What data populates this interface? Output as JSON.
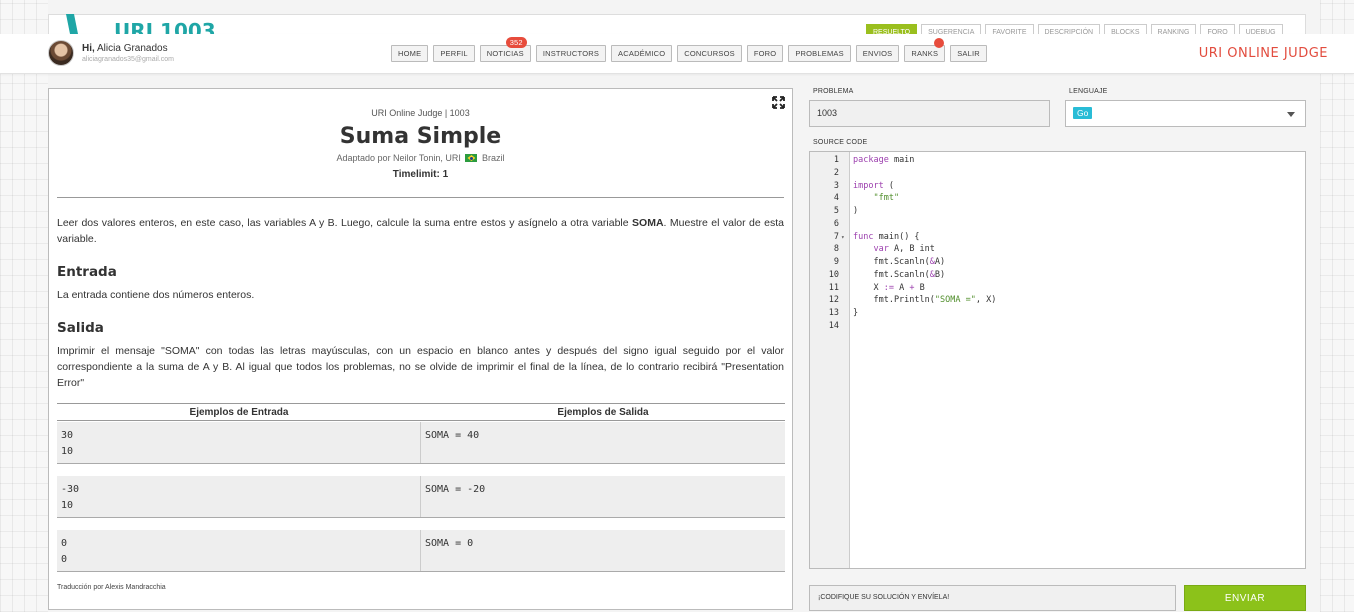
{
  "behind": {
    "title": "URI 1003",
    "tabs": [
      "RESUELTO",
      "SUGERENCIA",
      "FAVORITE",
      "DESCRIPCIÓN",
      "BLOCKS",
      "RANKING",
      "FORO",
      "UDEBUG"
    ]
  },
  "user": {
    "greeting": "Hi,",
    "name": "Alicia Granados",
    "email": "aliciagranados35@gmail.com"
  },
  "nav": {
    "items": [
      {
        "label": "HOME"
      },
      {
        "label": "PERFIL"
      },
      {
        "label": "NOTICIAS",
        "badge": "352"
      },
      {
        "label": "INSTRUCTORS"
      },
      {
        "label": "ACADÉMICO"
      },
      {
        "label": "CONCURSOS"
      },
      {
        "label": "FORO"
      },
      {
        "label": "PROBLEMAS"
      },
      {
        "label": "ENVIOS"
      },
      {
        "label": "RANKS"
      },
      {
        "label": "SALIR"
      }
    ],
    "brand": "URI ONLINE JUDGE"
  },
  "problem": {
    "meta": "URI Online Judge | 1003",
    "title": "Suma Simple",
    "author_prefix": "Adaptado por Neilor Tonin, URI",
    "country": "Brazil",
    "timelimit": "Timelimit: 1",
    "description_pre": "Leer dos valores enteros, en este caso, las variables A y B. Luego, calcule la suma entre estos y asígnelo a otra variable ",
    "description_bold": "SOMA",
    "description_post": ". Muestre el valor de esta variable.",
    "input_heading": "Entrada",
    "input_text": "La entrada contiene dos números enteros.",
    "output_heading": "Salida",
    "output_text": "Imprimir el mensaje \"SOMA\" con todas las letras mayúsculas, con un espacio en blanco antes y después del signo igual seguido por el valor correspondiente a la suma de A y B. Al igual que todos los problemas, no se olvide de imprimir el final de la línea, de lo contrario recibirá \"Presentation Error\"",
    "examples_input_header": "Ejemplos de Entrada",
    "examples_output_header": "Ejemplos de Salida",
    "examples": [
      {
        "input": "30\n10",
        "output": "SOMA = 40"
      },
      {
        "input": "-30\n10",
        "output": "SOMA = -20"
      },
      {
        "input": "0\n0",
        "output": "SOMA = 0"
      }
    ],
    "credit": "Traducción por Alexis Mandracchia"
  },
  "submit": {
    "problem_label": "PROBLEMA",
    "problem_value": "1003",
    "language_label": "LENGUAJE",
    "language_value": "Go",
    "source_label": "SOURCE CODE",
    "status_text": "¡CODIFIQUE SU SOLUCIÓN Y ENVÍELA!",
    "send_label": "ENVIAR"
  },
  "code_lines": [
    "package main",
    "",
    "import (",
    "    \"fmt\"",
    ")",
    "",
    "func main() {",
    "    var A, B int",
    "    fmt.Scanln(&A)",
    "    fmt.Scanln(&B)",
    "    X := A + B",
    "    fmt.Println(\"SOMA =\", X)",
    "}",
    ""
  ],
  "colors": {
    "brand": "#e24c3e",
    "accent_green": "#8cc21a",
    "teal": "#1fa6a6",
    "badge_red": "#e74c3c",
    "lang_chip": "#29bcd6"
  }
}
